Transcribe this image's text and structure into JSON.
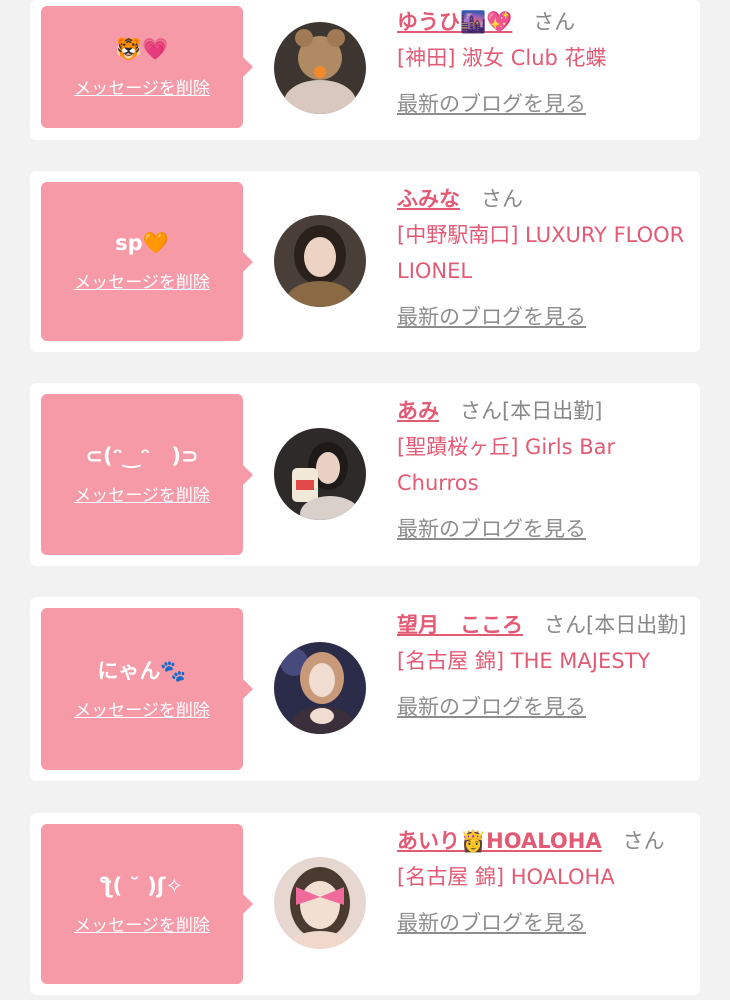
{
  "colors": {
    "background": "#f2f2f2",
    "card": "#ffffff",
    "bubble": "#f79aa8",
    "name": "#e25a74",
    "muted": "#8d8d8d"
  },
  "delete_label": "メッセージを削除",
  "blog_label": "最新のブログを見る",
  "cards": [
    {
      "message": "🐯💗",
      "name": "ゆうひ🌆💖",
      "san": "さん",
      "shop": "[神田] 淑女 Club 花蝶"
    },
    {
      "message": "sp🧡",
      "name": "ふみな",
      "san": "さん",
      "shop": "[中野駅南口] LUXURY FLOOR LIONEL"
    },
    {
      "message": "⊂(ᵔ‿ᵔ　)⊃",
      "name": "あみ",
      "san": "さん[本日出勤]",
      "shop": "[聖蹟桜ヶ丘] Girls Bar Churros"
    },
    {
      "message": "にゃん🐾",
      "name": "望月　こころ",
      "san": "さん[本日出勤]",
      "shop": "[名古屋 錦] THE MAJESTY"
    },
    {
      "message": "ƪ( ˘ )ʃ✧",
      "name": "あいり👸HOALOHA",
      "san": "さん",
      "shop": "[名古屋 錦] HOALOHA"
    }
  ]
}
